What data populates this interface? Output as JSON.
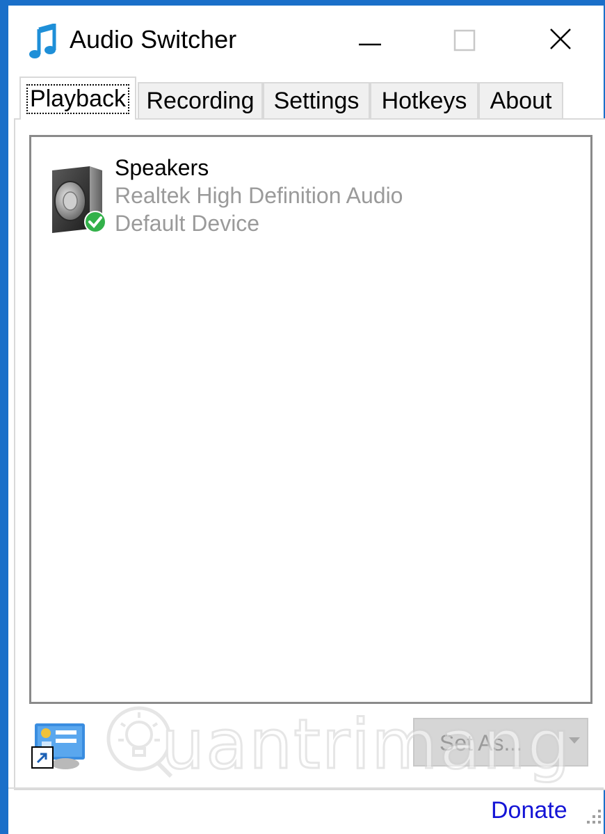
{
  "window": {
    "title": "Audio Switcher",
    "icon": "music-note-icon",
    "accent_color": "#1a6fc9",
    "controls": {
      "minimize": "minimize-icon",
      "maximize": "maximize-icon",
      "close": "close-icon"
    }
  },
  "tabs": [
    {
      "label": "Playback",
      "active": true
    },
    {
      "label": "Recording",
      "active": false
    },
    {
      "label": "Settings",
      "active": false
    },
    {
      "label": "Hotkeys",
      "active": false
    },
    {
      "label": "About",
      "active": false
    }
  ],
  "devices": [
    {
      "name": "Speakers",
      "description": "Realtek High Definition Audio",
      "status": "Default Device",
      "icon": "speaker-default-icon"
    }
  ],
  "footer": {
    "set_as_label": "Set As...",
    "donate_label": "Donate",
    "donate_color": "#1414d6"
  },
  "watermark": {
    "text": "uantrimang"
  }
}
